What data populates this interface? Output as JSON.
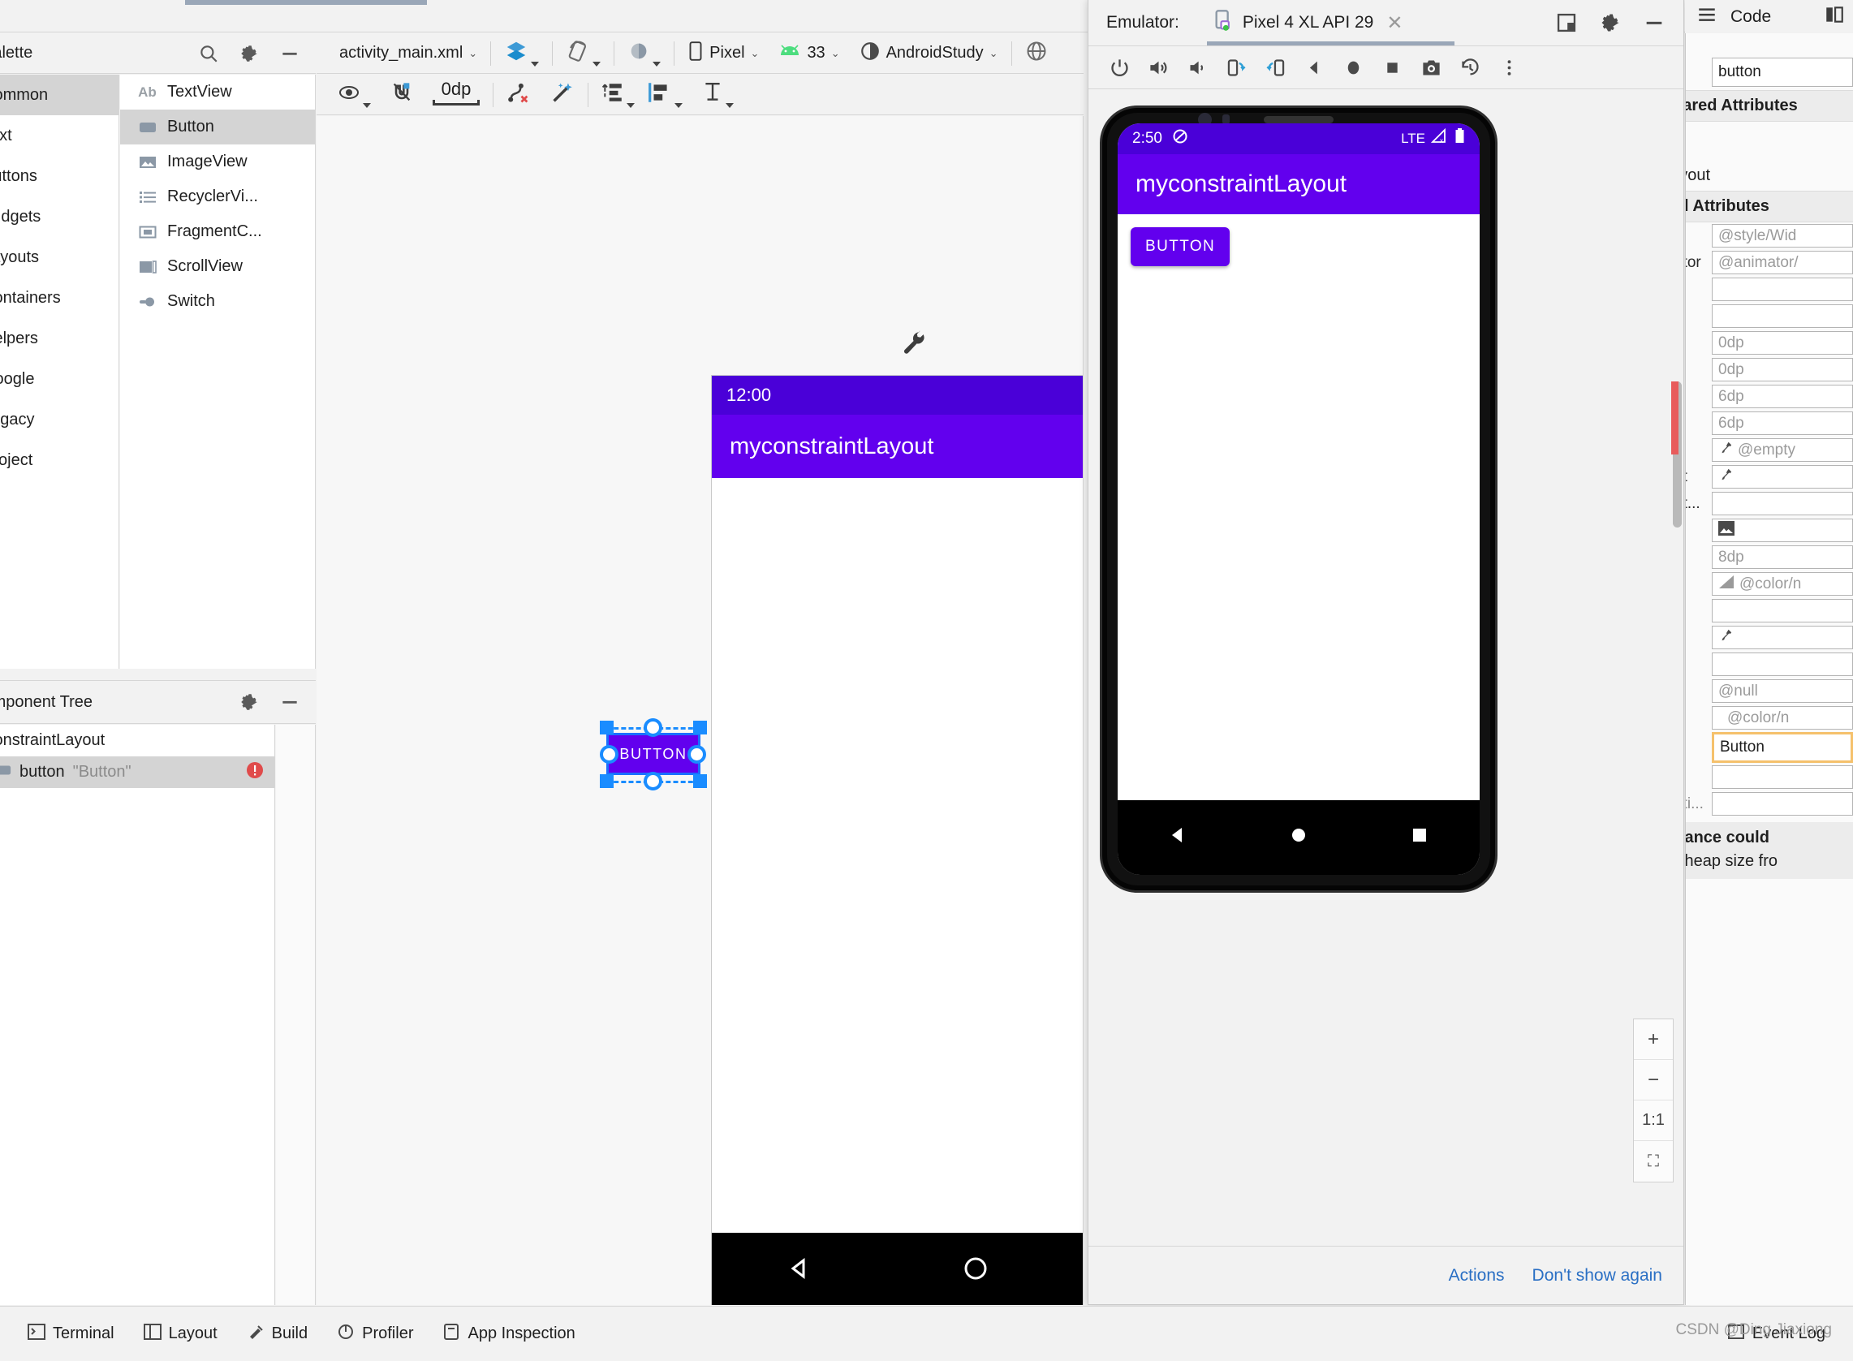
{
  "top": {
    "tab_marker": ""
  },
  "palette": {
    "title": "Palette",
    "search_icon": "search-icon",
    "gear_icon": "gear-icon",
    "minimize_icon": "minimize-icon",
    "categories": [
      {
        "label": "Common",
        "selected": true
      },
      {
        "label": "Text",
        "selected": false
      },
      {
        "label": "Buttons",
        "selected": false
      },
      {
        "label": "Widgets",
        "selected": false
      },
      {
        "label": "Layouts",
        "selected": false
      },
      {
        "label": "Containers",
        "selected": false
      },
      {
        "label": "Helpers",
        "selected": false
      },
      {
        "label": "Google",
        "selected": false
      },
      {
        "label": "Legacy",
        "selected": false
      },
      {
        "label": "Project",
        "selected": false
      }
    ],
    "items": [
      {
        "label": "TextView",
        "icon": "textview-icon",
        "selected": false
      },
      {
        "label": "Button",
        "icon": "button-icon",
        "selected": true
      },
      {
        "label": "ImageView",
        "icon": "imageview-icon",
        "selected": false
      },
      {
        "label": "RecyclerVi...",
        "icon": "recyclerview-icon",
        "selected": false
      },
      {
        "label": "FragmentC...",
        "icon": "fragment-icon",
        "selected": false
      },
      {
        "label": "ScrollView",
        "icon": "scrollview-icon",
        "selected": false
      },
      {
        "label": "Switch",
        "icon": "switch-icon",
        "selected": false
      }
    ]
  },
  "component_tree": {
    "title": "Component Tree",
    "gear_icon": "gear-icon",
    "minimize_icon": "minimize-icon",
    "rows": [
      {
        "name": "ConstraintLayout",
        "value": "",
        "selected": false,
        "warning": false
      },
      {
        "name": "button",
        "value": "\"Button\"",
        "selected": true,
        "warning": true
      }
    ]
  },
  "design_toolbar": {
    "file_name": "activity_main.xml",
    "view_mode_icon": "design-views-icon",
    "orientation_icon": "rotate-device-icon",
    "theme_icon": "theme-icon",
    "device": "Pixel",
    "api_level": "33",
    "theme": "AndroidStudy",
    "locale_icon": "globe-icon"
  },
  "design_toolbar2": {
    "visibility_icon": "eye-icon",
    "autoconnect_icon": "magnet-off-icon",
    "default_margin": "0dp",
    "clear_constraints_icon": "clear-constraints-icon",
    "infer_constraints_icon": "magic-wand-icon",
    "pack_icon": "pack-icon",
    "align_icon": "align-icon",
    "guidelines_icon": "guidelines-icon"
  },
  "preview": {
    "status_time": "12:00",
    "wifi_icon": "wifi-icon",
    "battery_icon": "battery-icon",
    "app_title": "myconstraintLayout",
    "button_label": "BUTTON",
    "nav_back_icon": "nav-back-icon",
    "nav_home_icon": "nav-home-icon",
    "nav_recents_icon": "nav-recents-icon",
    "wrench_icon": "wrench-icon"
  },
  "emulator": {
    "window_label": "Emulator:",
    "tab_title": "Pixel 4 XL API 29",
    "tab_device_icon": "device-running-icon",
    "tab_close_icon": "close-icon",
    "split_icon": "split-window-icon",
    "gear_icon": "gear-icon",
    "minimize_icon": "minimize-icon",
    "toolbar": [
      {
        "icon": "power-icon",
        "name": "power-button"
      },
      {
        "icon": "volume-up-icon",
        "name": "volume-up-button"
      },
      {
        "icon": "volume-down-icon",
        "name": "volume-down-button"
      },
      {
        "icon": "rotate-left-icon",
        "name": "rotate-left-button"
      },
      {
        "icon": "rotate-right-icon",
        "name": "rotate-right-button"
      },
      {
        "icon": "back-icon",
        "name": "back-button"
      },
      {
        "icon": "home-icon",
        "name": "home-button"
      },
      {
        "icon": "overview-icon",
        "name": "overview-button"
      },
      {
        "icon": "screenshot-icon",
        "name": "screenshot-button"
      },
      {
        "icon": "history-icon",
        "name": "history-button"
      },
      {
        "icon": "more-vertical-icon",
        "name": "more-button"
      }
    ],
    "device_screen": {
      "status_time": "2:50",
      "do_not_disturb_icon": "do-not-disturb-icon",
      "network": "LTE",
      "signal_icon": "signal-off-icon",
      "battery_icon": "battery-icon",
      "app_title": "myconstraintLayout",
      "button_label": "BUTTON",
      "nav_back_icon": "nav-back-icon",
      "nav_home_icon": "nav-home-icon",
      "nav_recents_icon": "nav-recents-icon"
    },
    "zoom_controls": [
      {
        "label": "+",
        "name": "zoom-in-button"
      },
      {
        "label": "−",
        "name": "zoom-out-button"
      },
      {
        "label": "1:1",
        "name": "zoom-actual-button"
      },
      {
        "label": "⛶",
        "name": "zoom-fit-button"
      }
    ],
    "footer": {
      "actions_label": "Actions",
      "dismiss_label": "Don't show again"
    }
  },
  "code_strip": {
    "code_label": "Code",
    "menu_icon": "hamburger-icon",
    "split_icon": "split-editor-icon"
  },
  "attributes": {
    "id_value": "button",
    "section_declared": "Declared Attributes",
    "section_layout": "Layout",
    "section_all": "All Attributes",
    "rows": [
      {
        "label": "",
        "value": "@style/Wid",
        "placeholder": true,
        "icon": ""
      },
      {
        "label": "ator",
        "value": "@animator/",
        "placeholder": true,
        "icon": ""
      },
      {
        "label": "",
        "value": "",
        "placeholder": true,
        "icon": ""
      },
      {
        "label": "",
        "value": "",
        "placeholder": true,
        "icon": ""
      },
      {
        "label": "",
        "value": "0dp",
        "placeholder": true,
        "icon": ""
      },
      {
        "label": "",
        "value": "0dp",
        "placeholder": true,
        "icon": ""
      },
      {
        "label": "",
        "value": "6dp",
        "placeholder": true,
        "icon": ""
      },
      {
        "label": "",
        "value": "6dp",
        "placeholder": true,
        "icon": ""
      },
      {
        "label": "",
        "value": "@empty",
        "placeholder": true,
        "icon": "eyedropper-icon"
      },
      {
        "label": "nt",
        "value": "",
        "placeholder": true,
        "icon": "eyedropper-icon"
      },
      {
        "label": "nt...",
        "value": "",
        "placeholder": true,
        "icon": ""
      },
      {
        "label": "",
        "value": "",
        "placeholder": true,
        "icon": "image-icon"
      },
      {
        "label": "",
        "value": "8dp",
        "placeholder": true,
        "icon": ""
      },
      {
        "label": "",
        "value": "@color/n",
        "placeholder": true,
        "icon": "color-swatch-icon"
      },
      {
        "label": "",
        "value": "",
        "placeholder": true,
        "icon": ""
      },
      {
        "label": "",
        "value": "",
        "placeholder": true,
        "icon": "eyedropper-icon"
      },
      {
        "label": "",
        "value": "",
        "placeholder": true,
        "icon": ""
      },
      {
        "label": "",
        "value": "@null",
        "placeholder": true,
        "icon": ""
      },
      {
        "label": "",
        "value": "@color/n",
        "placeholder": true,
        "icon": ""
      },
      {
        "label": "",
        "value": "Button",
        "placeholder": false,
        "highlight": true,
        "icon": ""
      },
      {
        "label": "",
        "value": "",
        "placeholder": true,
        "icon": ""
      },
      {
        "label": "oti...",
        "value": "",
        "placeholder": true,
        "icon": ""
      }
    ],
    "warning_line1": "formance could",
    "warning_line2": "num heap size fro"
  },
  "bottom_bar": {
    "items": [
      {
        "label": "Terminal",
        "icon": "terminal-icon"
      },
      {
        "label": "Layout",
        "icon": "layout-icon"
      },
      {
        "label": "Build",
        "icon": "build-icon"
      },
      {
        "label": "Profiler",
        "icon": "profiler-icon"
      },
      {
        "label": "App Inspection",
        "icon": "inspection-icon"
      }
    ],
    "right_label": "Event Log"
  },
  "watermark": "CSDN @Ding Jiaxiong"
}
